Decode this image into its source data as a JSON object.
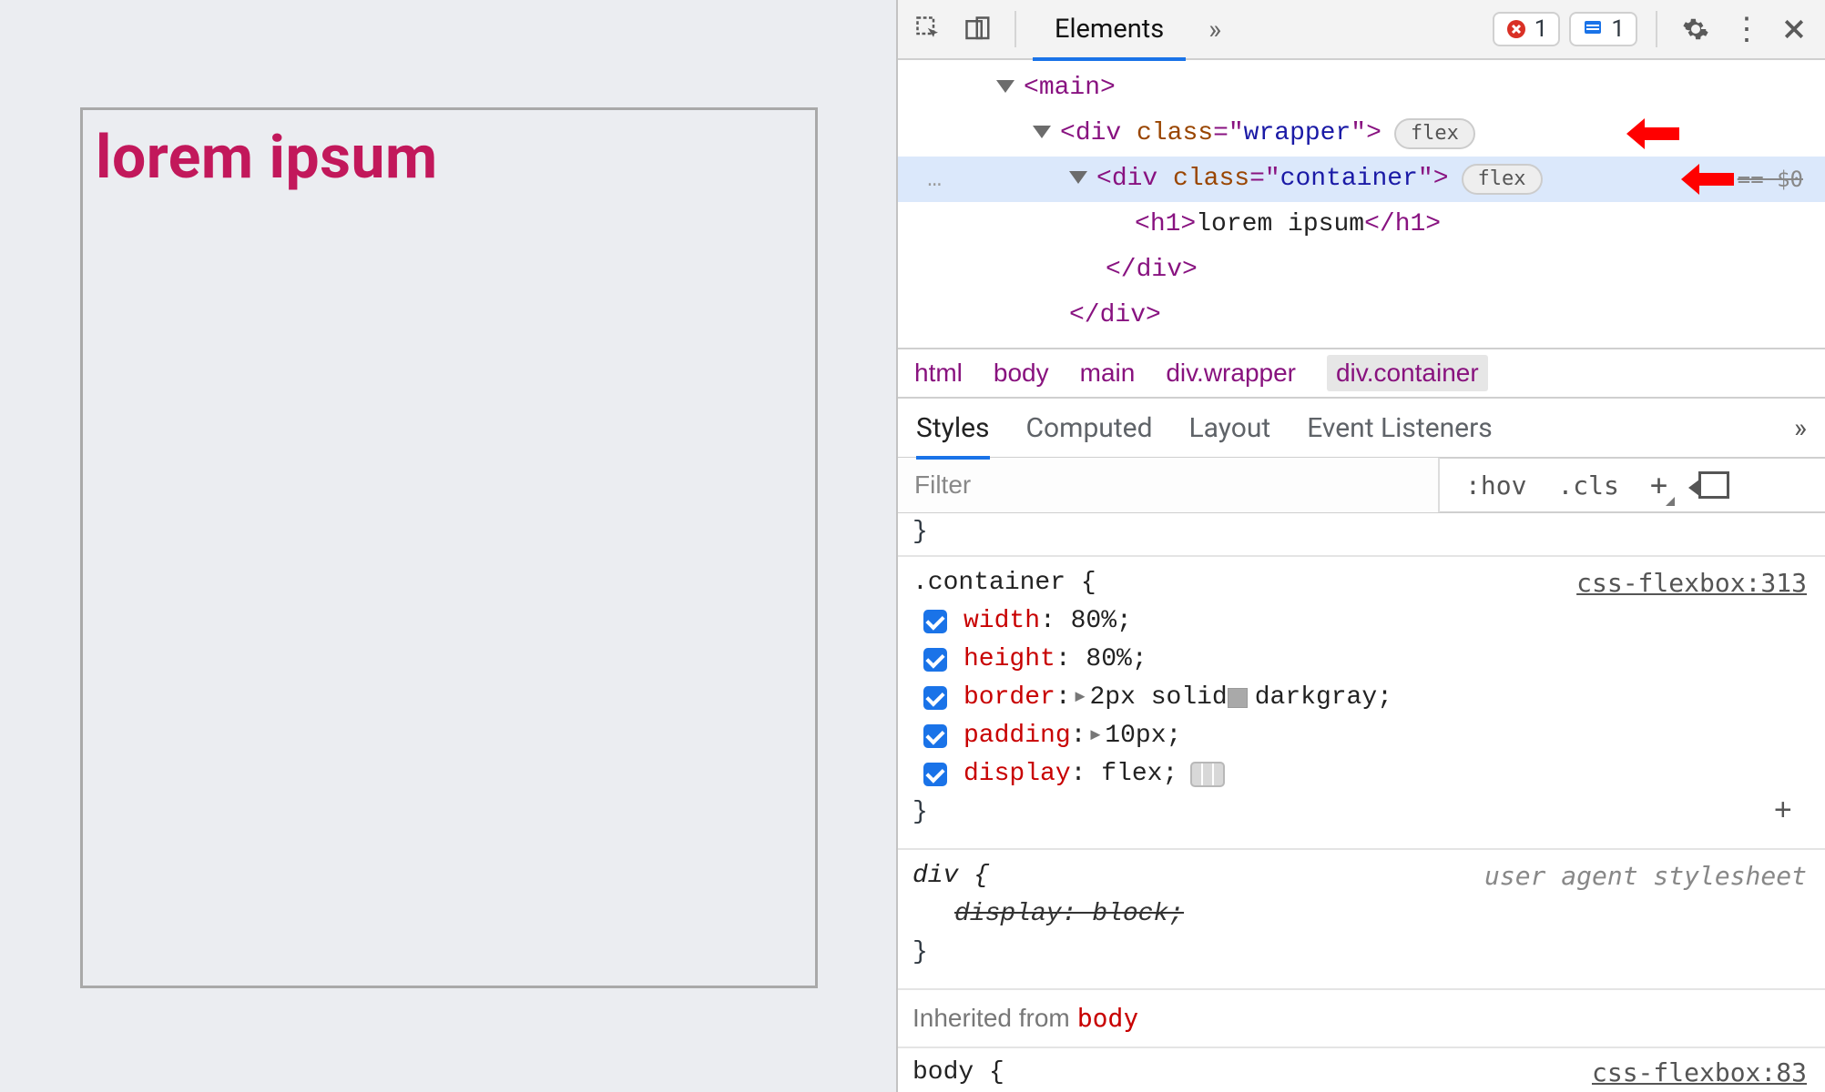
{
  "preview": {
    "heading": "lorem ipsum"
  },
  "toolbar": {
    "tabs": {
      "elements": "Elements"
    },
    "errors": {
      "count": "1"
    },
    "issues": {
      "count": "1"
    }
  },
  "domTree": {
    "l0": {
      "open": "<",
      "tag": "main",
      "close": ">"
    },
    "l1": {
      "open": "<",
      "tag": "div",
      "sp": " ",
      "attrn": "class",
      "eq": "=\"",
      "attrv": "wrapper",
      "endq": "\"",
      "close": ">",
      "badge": "flex"
    },
    "l2": {
      "gutter": "…",
      "open": "<",
      "tag": "div",
      "sp": " ",
      "attrn": "class",
      "eq": "=\"",
      "attrv": "container",
      "endq": "\"",
      "close": ">",
      "badge": "flex",
      "endmark": "== $0"
    },
    "l3": {
      "open": "<",
      "tag": "h1",
      "close": ">",
      "text": "lorem ipsum",
      "copen": "</",
      "ctag": "h1",
      "cclose": ">"
    },
    "l4": {
      "open": "</",
      "tag": "div",
      "close": ">"
    },
    "l5": {
      "open": "</",
      "tag": "div",
      "close": ">"
    }
  },
  "breadcrumb": {
    "c0": "html",
    "c1": "body",
    "c2": "main",
    "c3": "div.wrapper",
    "c4": "div.container"
  },
  "stylesTabs": {
    "t0": "Styles",
    "t1": "Computed",
    "t2": "Layout",
    "t3": "Event Listeners"
  },
  "filter": {
    "placeholder": "Filter",
    "hov": ":hov",
    "cls": ".cls"
  },
  "rules": {
    "container": {
      "selector": ".container {",
      "source": "css-flexbox:313",
      "d0": {
        "p": "width",
        "v": ": 80%;"
      },
      "d1": {
        "p": "height",
        "v": ": 80%;"
      },
      "d2": {
        "p": "border",
        "vpre": ": ",
        "exp": "▸",
        "vmid": " 2px solid ",
        "color": "darkgray",
        "vend": ";"
      },
      "d3": {
        "p": "padding",
        "vpre": ": ",
        "exp": "▸",
        "v": " 10px;"
      },
      "d4": {
        "p": "display",
        "v": ": flex;"
      },
      "close": "}"
    },
    "div": {
      "selector": "div {",
      "source": "user agent stylesheet",
      "strike": "display: block;",
      "close": "}"
    },
    "inherit": {
      "label": "Inherited from",
      "from": "body"
    },
    "bodyPartial": {
      "selector": "body {",
      "source": "css-flexbox:83"
    }
  }
}
